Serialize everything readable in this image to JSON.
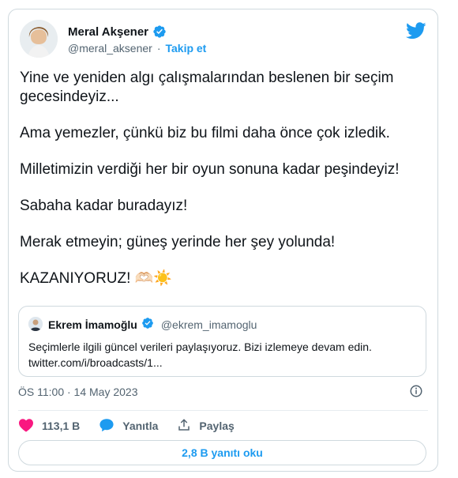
{
  "author": {
    "name": "Meral Akşener",
    "handle": "@meral_aksener",
    "separator": "·",
    "follow_label": "Takip et"
  },
  "tweet": {
    "paragraphs": [
      "Yine ve yeniden algı çalışmalarından beslenen bir seçim gecesindeyiz...",
      "Ama yemezler, çünkü biz bu filmi daha önce çok izledik.",
      "Milletimizin verdiği her bir oyun sonuna kadar peşindeyiz!",
      "Sabaha kadar buradayız!",
      "Merak etmeyin; güneş yerinde her şey yolunda!",
      "KAZANIYORUZ! 🫶🏻☀️"
    ]
  },
  "quote": {
    "name": "Ekrem İmamoğlu",
    "handle": "@ekrem_imamoglu",
    "text": "Seçimlerle ilgili güncel verileri paylaşıyoruz. Bizi izlemeye devam edin. twitter.com/i/broadcasts/1..."
  },
  "meta": {
    "timestamp": "ÖS 11:00 · 14 May 2023"
  },
  "actions": {
    "likes": "113,1 B",
    "reply_label": "Yanıtla",
    "share_label": "Paylaş"
  },
  "replies": {
    "label": "2,8 B yanıtı oku"
  },
  "colors": {
    "accent": "#1d9bf0",
    "like": "#f91880",
    "text": "#0f1419",
    "muted": "#536471",
    "border": "#cfd9de"
  },
  "icons": [
    "verified-badge-icon",
    "twitter-bird-icon",
    "info-icon",
    "heart-icon",
    "reply-bubble-icon",
    "share-icon"
  ]
}
